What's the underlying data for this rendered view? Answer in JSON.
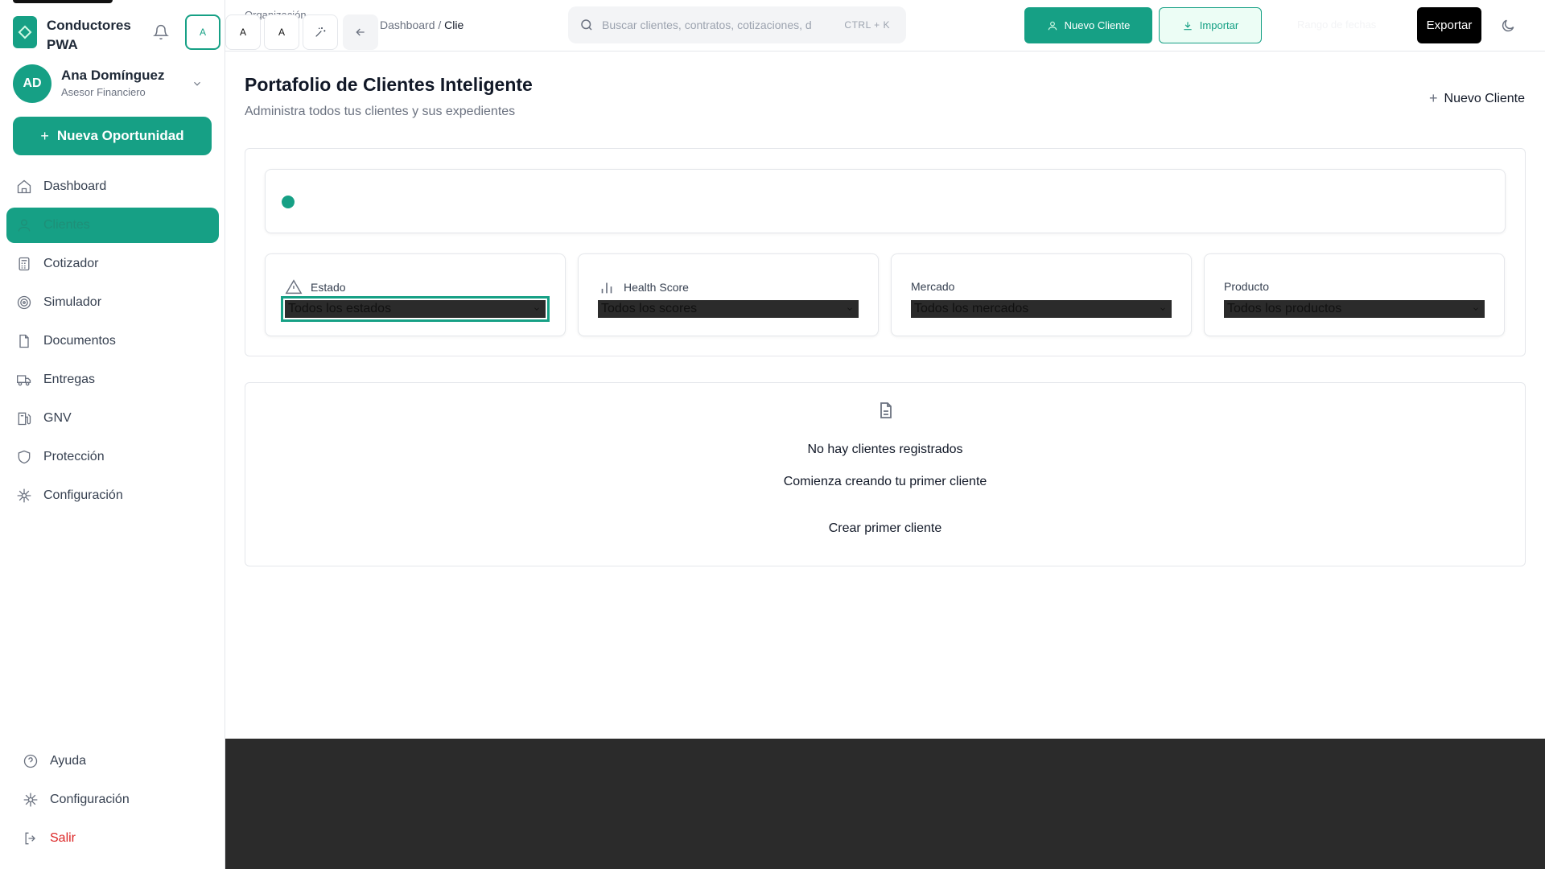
{
  "app": {
    "name": "Conductores PWA"
  },
  "header": {
    "avatar_letter": "A",
    "chip_a1": "A",
    "chip_a2": "A",
    "org_label": "Organización",
    "breadcrumb_root": "Dashboard /",
    "breadcrumb_current": "Clie",
    "search_placeholder": "Buscar clientes, contratos, cotizaciones, d",
    "search_shortcut": "CTRL + K",
    "new_client_label": "Nuevo Cliente",
    "import_label": "Importar",
    "date_range_label": "Rango de fechas",
    "export_label": "Exportar"
  },
  "user": {
    "initials": "AD",
    "name": "Ana Domínguez",
    "role": "Asesor Financiero"
  },
  "sidebar": {
    "new_opportunity": "Nueva Oportunidad",
    "items": [
      {
        "label": "Dashboard",
        "icon": "home-icon"
      },
      {
        "label": "Clientes",
        "icon": "user-icon",
        "active": true
      },
      {
        "label": "Cotizador",
        "icon": "calculator-icon"
      },
      {
        "label": "Simulador",
        "icon": "target-icon"
      },
      {
        "label": "Documentos",
        "icon": "document-icon"
      },
      {
        "label": "Entregas",
        "icon": "truck-icon"
      },
      {
        "label": "GNV",
        "icon": "fuel-icon"
      },
      {
        "label": "Protección",
        "icon": "shield-icon"
      },
      {
        "label": "Configuración",
        "icon": "gear-icon"
      }
    ],
    "bottom": [
      {
        "label": "Ayuda",
        "icon": "help-icon"
      },
      {
        "label": "Configuración",
        "icon": "gear-icon"
      },
      {
        "label": "Salir",
        "icon": "logout-icon"
      }
    ]
  },
  "page": {
    "title": "Portafolio de Clientes Inteligente",
    "subtitle": "Administra todos tus clientes y sus expedientes",
    "new_client_link": "Nuevo Cliente"
  },
  "filters": [
    {
      "label": "Estado",
      "value": "Todos los estados"
    },
    {
      "label": "Health Score",
      "value": "Todos los scores"
    },
    {
      "label": "Mercado",
      "value": "Todos los mercados"
    },
    {
      "label": "Producto",
      "value": "Todos los productos"
    }
  ],
  "empty_state": {
    "title": "No hay clientes registrados",
    "subtitle": "Comienza creando tu primer cliente",
    "cta": "Crear primer cliente"
  },
  "colors": {
    "accent": "#16a085",
    "danger": "#dc2626",
    "dark_band": "#2b2b2b"
  }
}
